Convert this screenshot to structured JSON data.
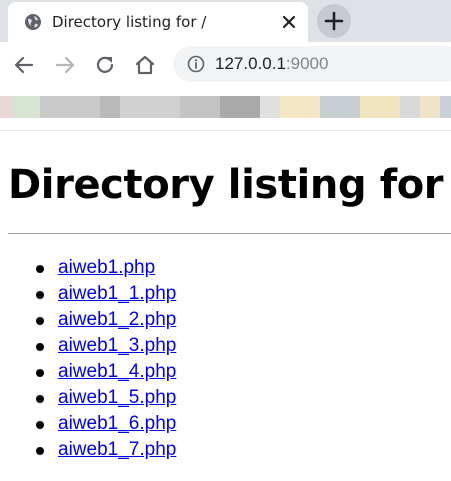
{
  "tab": {
    "title": "Directory listing for /"
  },
  "toolbar": {
    "url_host": "127.0.0.1",
    "url_port": ":9000"
  },
  "page": {
    "heading": "Directory listing for /",
    "files": [
      "aiweb1.php",
      "aiweb1_1.php",
      "aiweb1_2.php",
      "aiweb1_3.php",
      "aiweb1_4.php",
      "aiweb1_5.php",
      "aiweb1_6.php",
      "aiweb1_7.php"
    ]
  },
  "icons": {
    "favicon": "globe-icon",
    "close": "close-icon",
    "new_tab": "plus-icon",
    "back": "back-arrow-icon",
    "forward": "forward-arrow-icon",
    "reload": "reload-icon",
    "home": "home-icon",
    "site_info": "info-icon"
  },
  "colors": {
    "link": "#0000ee",
    "tabstrip": "#dee1e6",
    "omnibox": "#f1f3f4"
  }
}
